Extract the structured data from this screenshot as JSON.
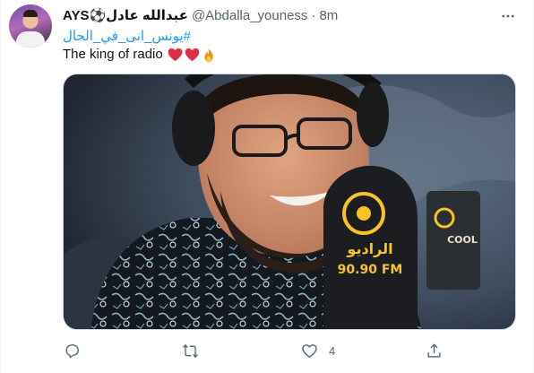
{
  "tweet": {
    "display_name": "AYS⚽️عبدالله عادل",
    "handle": "@Abdalla_youness",
    "separator": "·",
    "time": "8m",
    "hashtag": "#يونس_انى_في_الحال",
    "text": "The king of radio",
    "emojis": [
      "heart-icon",
      "heart-icon",
      "fire-icon"
    ]
  },
  "media": {
    "mic_station_text": "الراديو",
    "mic_frequency": "90.90 FM",
    "side_sign_text": "COOL"
  },
  "actions": {
    "reply_count": "",
    "retweet_count": "",
    "like_count": "4",
    "share_count": ""
  },
  "colors": {
    "link": "#1d9bf0",
    "secondary_text": "#536471",
    "heart": "#e0245e",
    "mic_brand": "#f7c325"
  }
}
